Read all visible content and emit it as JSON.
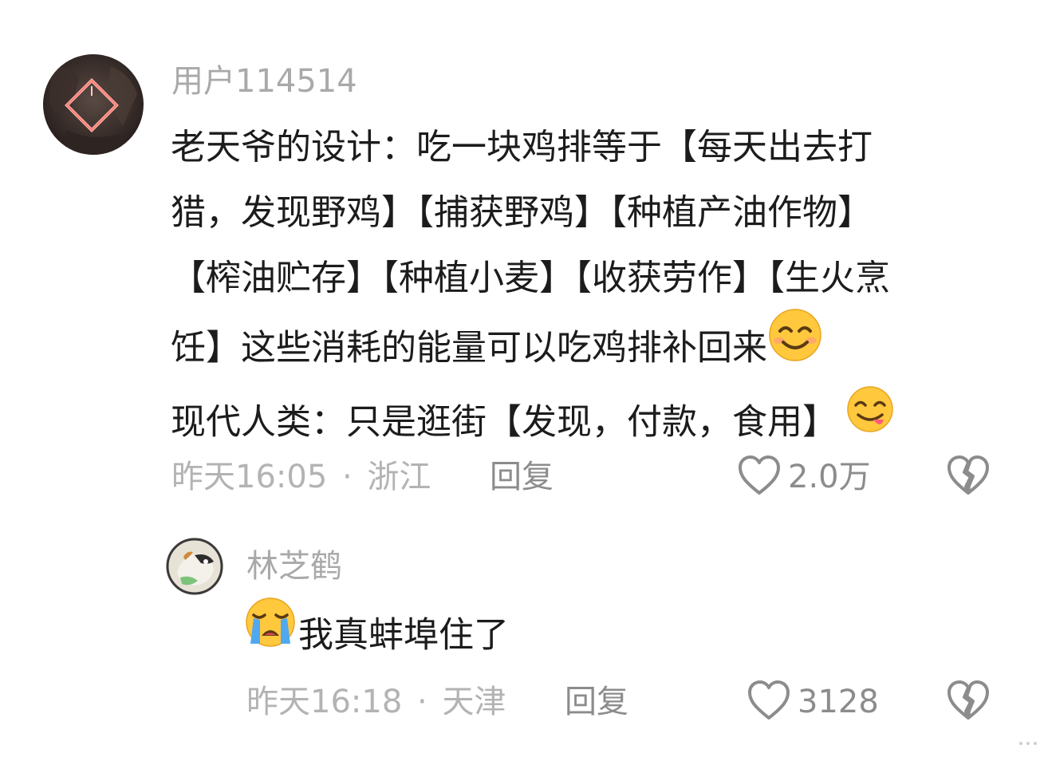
{
  "comments": [
    {
      "username": "用户114514",
      "lines": [
        "老天爷的设计：吃一块鸡排等于【每天出去打",
        "猎，发现野鸡】【捕获野鸡】【种植产油作物】",
        "【榨油贮存】【种植小麦】【收获劳作】【生火烹",
        "饪】这些消耗的能量可以吃鸡排补回来",
        "现代人类：只是逛街【发现，付款，食用】"
      ],
      "line4_emoji": "smiling-face-emoji",
      "line5_emoji": "savoring-food-emoji",
      "time": "昨天16:05",
      "separator": "·",
      "location": "浙江",
      "reply_label": "回复",
      "likes": "2.0万"
    },
    {
      "username": "林芝鹤",
      "text": "我真蚌埠住了",
      "prefix_emoji": "loudly-crying-face-emoji",
      "time": "昨天16:18",
      "separator": "·",
      "location": "天津",
      "reply_label": "回复",
      "likes": "3128"
    }
  ],
  "icons": {
    "like": "heart-outline-icon",
    "dislike": "broken-heart-icon"
  },
  "colors": {
    "username": "#a9a9a9",
    "body_text": "#1c1c1c",
    "meta_text": "#b3b3b3",
    "action_text": "#8c8c8c",
    "emoji_yellow": "#ffc83d",
    "avatar_accent": "#ff8080"
  }
}
